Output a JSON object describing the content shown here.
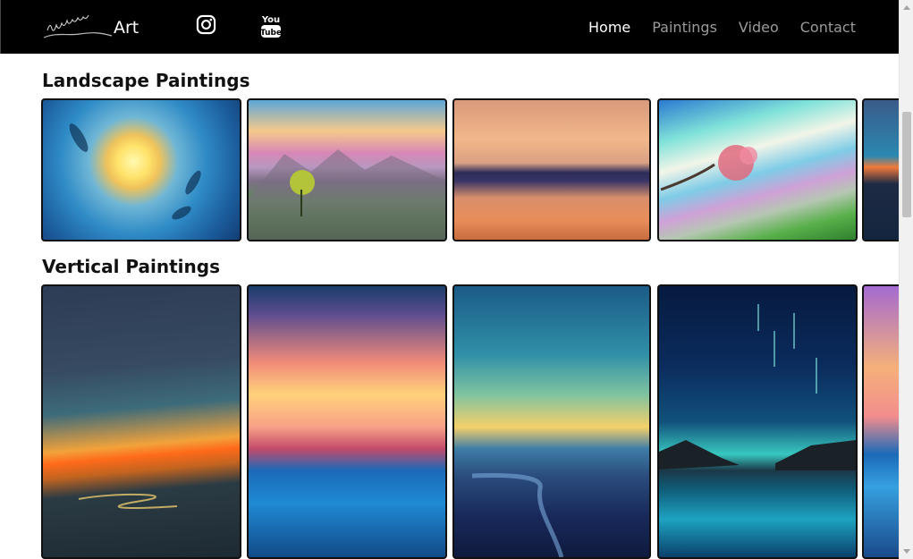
{
  "header": {
    "brand_text": "Art",
    "nav": [
      {
        "label": "Home",
        "active": true
      },
      {
        "label": "Paintings",
        "active": false
      },
      {
        "label": "Video",
        "active": false
      },
      {
        "label": "Contact",
        "active": false
      }
    ],
    "social_icons": [
      "instagram-icon",
      "youtube-icon"
    ],
    "youtube_icon_text": [
      "You",
      "Tube"
    ]
  },
  "sections": [
    {
      "title": "Landscape Paintings",
      "paintings": [
        {
          "style": "p-l1"
        },
        {
          "style": "p-l2"
        },
        {
          "style": "p-l3"
        },
        {
          "style": "p-l4"
        },
        {
          "style": "p-l5"
        }
      ]
    },
    {
      "title": "Vertical Paintings",
      "paintings": [
        {
          "style": "p-v1"
        },
        {
          "style": "p-v2"
        },
        {
          "style": "p-v3"
        },
        {
          "style": "p-v4"
        },
        {
          "style": "p-v5"
        }
      ]
    }
  ],
  "colors": {
    "navbar_bg": "#000000",
    "nav_active": "#ffffff",
    "nav_inactive": "#9a9a9a",
    "heading": "#111111"
  }
}
